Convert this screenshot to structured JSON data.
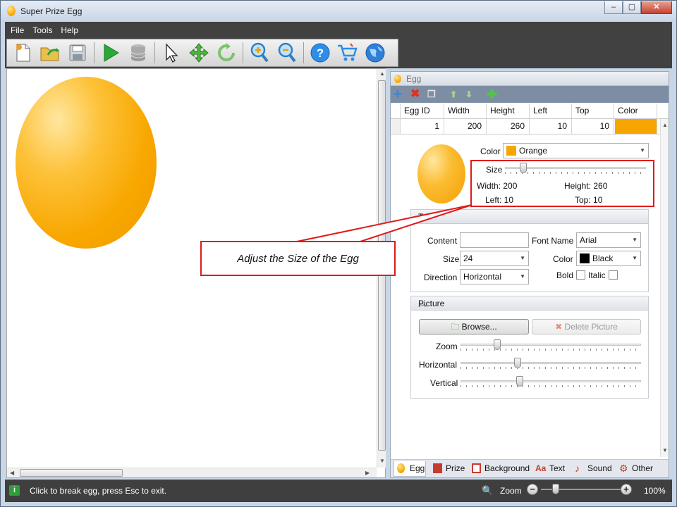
{
  "window": {
    "title": "Super Prize Egg"
  },
  "menu": [
    "File",
    "Tools",
    "Help"
  ],
  "toolbar_icons": [
    "new-file-icon",
    "open-folder-icon",
    "save-icon",
    "play-icon",
    "database-icon",
    "pointer-icon",
    "move-icon",
    "rotate-icon",
    "zoom-in-icon",
    "zoom-out-icon",
    "help-icon",
    "cart-icon",
    "globe-icon"
  ],
  "egg_panel": {
    "title": "Egg",
    "grid": {
      "headers": [
        "Egg ID",
        "Width",
        "Height",
        "Left",
        "Top",
        "Color"
      ],
      "row": {
        "id": "1",
        "width": "200",
        "height": "260",
        "left": "10",
        "top": "10",
        "color": "#f7a500"
      }
    },
    "color_label": "Color",
    "color_value": "Orange",
    "size_label": "Size",
    "size_level": 0.11,
    "width_text": "Width: 200",
    "height_text": "Height: 260",
    "left_text": "Left: 10",
    "top_text": "Top: 10"
  },
  "text_group": {
    "title": "T",
    "content_label": "Content",
    "content_value": "",
    "font_name_label": "Font Name",
    "font_name_value": "Arial",
    "size_label": "Size",
    "size_value": "24",
    "color_label": "Color",
    "color_value": "Black",
    "direction_label": "Direction",
    "direction_value": "Horizontal",
    "bold_label": "Bold",
    "italic_label": "Italic"
  },
  "picture_group": {
    "title": "Picture",
    "browse_label": "Browse...",
    "delete_label": "Delete Picture",
    "zoom_label": "Zoom",
    "zoom_level": 0.19,
    "horizontal_label": "Horizontal",
    "horizontal_level": 0.31,
    "vertical_label": "Vertical",
    "vertical_level": 0.32
  },
  "tabs": [
    "Egg",
    "Prize",
    "Background",
    "Text",
    "Sound",
    "Other"
  ],
  "callout": {
    "text": "Adjust the Size of the Egg"
  },
  "status": {
    "message": "Click to break egg, press Esc to exit.",
    "zoom_label": "Zoom",
    "zoom_value": "100%"
  },
  "colors": {
    "accent_red": "#e01a1a",
    "egg_orange": "#f7a500",
    "dark_band": "#414141"
  }
}
